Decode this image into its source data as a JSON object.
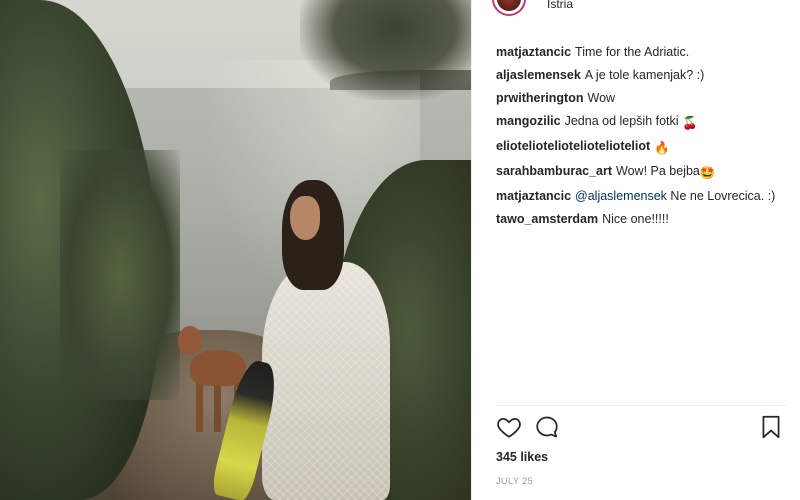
{
  "post": {
    "location": "Istria",
    "photo_icon": "beach-photo"
  },
  "comments": [
    {
      "user": "matjaztancic",
      "text": "Time for the Adriatic."
    },
    {
      "user": "aljaslemensek",
      "text": "A je tole kamenjak? :)"
    },
    {
      "user": "prwitherington",
      "text": "Wow"
    },
    {
      "user": "mangozilic",
      "text": "Jedna od lepših fotki",
      "emoji": "🍒"
    },
    {
      "user": "elioteliotelioteliotelioteliot",
      "text": "",
      "emoji": "🔥"
    },
    {
      "user": "sarahbamburac_art",
      "text": "Wow! Pa bejba",
      "emoji": "🤩"
    },
    {
      "user": "matjaztancic",
      "mention": "@aljaslemensek",
      "text": "Ne ne Lovrecica. :)"
    },
    {
      "user": "tawo_amsterdam",
      "text": "Nice one!!!!!"
    }
  ],
  "actions": {
    "like_icon": "heart-icon",
    "comment_icon": "comment-icon",
    "save_icon": "bookmark-icon"
  },
  "likes": "345 likes",
  "date": "JULY 25",
  "colors": {
    "text": "#262626",
    "mention": "#003569",
    "muted": "#999999",
    "divider": "#efefef"
  }
}
